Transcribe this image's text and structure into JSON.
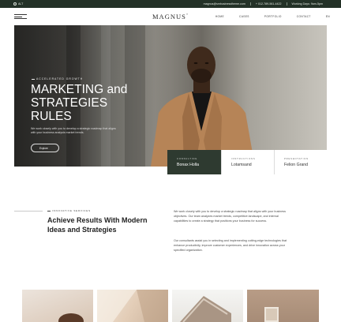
{
  "topbar": {
    "language": "ALT",
    "email": "magnus@smbusinesstheme.com",
    "phone": "+ 012-789-561-4422",
    "hours": "Working Days: 9am-5pm"
  },
  "header": {
    "logo": "MAGNUS",
    "logo_mark": "®",
    "nav": [
      "HOME",
      "CASES",
      "PORTFOLIO",
      "CONTACT",
      "EN"
    ]
  },
  "hero": {
    "eyebrow": "ACCELERATED GROWTH",
    "title": "MARKETING and STRATEGIES RULES",
    "description": "We work closely with you to develop a strategic roadmap that aligns with your business analysis market trends.",
    "button": "Explore"
  },
  "cards": [
    {
      "label": "CONSULTING",
      "value": "Bonax Holla"
    },
    {
      "label": "INSTRUCTIONS",
      "value": "Lotamsand"
    },
    {
      "label": "PRESENTATION",
      "value": "Felion Grand"
    }
  ],
  "about": {
    "eyebrow": "INNOVATIVE SERVICES",
    "title": "Achieve Results With Modern Ideas and Strategies",
    "paragraph1": "We work closely with you to develop a strategic roadmap that aligns with your business objectives. Our team analyzes market trends, competitive landscape, and internal capabilities to create a strategy that positions your business for success.",
    "paragraph2": "Our consultants assist you in selecting and implementing cutting-edge technologies that enhance productivity, improve customer experiences, and drive innovation across your specified organization."
  },
  "colors": {
    "topbar": "#233127",
    "card_dark": "#2e3a30"
  }
}
